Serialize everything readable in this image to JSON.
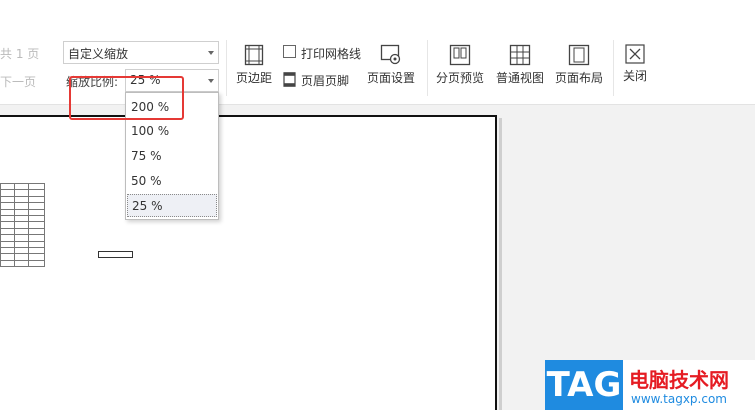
{
  "nav": {
    "page_label": "共 1 页",
    "next_page": "下一页"
  },
  "zoom_mode": {
    "value": "自定义缩放"
  },
  "zoom_ratio": {
    "label": "缩放比例:",
    "value": "25 %"
  },
  "toolbar": {
    "print_gridlines": "打印网格线",
    "margins": "页边距",
    "header_footer": "页眉页脚",
    "page_setup": "页面设置",
    "page_break_preview": "分页预览",
    "normal_view": "普通视图",
    "page_layout": "页面布局",
    "close": "关闭"
  },
  "dropdown": {
    "options": [
      "200 %",
      "100 %",
      "75 %",
      "50 %",
      "25 %"
    ],
    "selected": "25 %"
  },
  "watermark": {
    "tag": "TAG",
    "title": "电脑技术网",
    "url": "www.tagxp.com"
  },
  "colors": {
    "highlight": "#e53935",
    "accent": "#1f8be0",
    "brand_red": "#e51c23"
  },
  "icons": [
    "page-margin-icon",
    "header-footer-icon",
    "page-setup-icon",
    "page-break-preview-icon",
    "normal-view-icon",
    "page-layout-icon",
    "close-icon",
    "checkbox-icon",
    "chevron-down-icon"
  ]
}
